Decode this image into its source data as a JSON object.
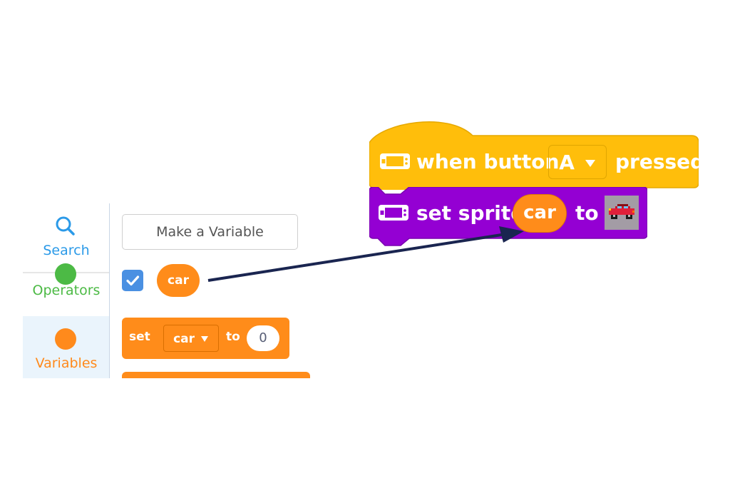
{
  "categories": [
    {
      "label": "Search",
      "icon": "search-icon",
      "color": "#2b9ae8"
    },
    {
      "label": "Operators",
      "icon": "operators-dot-icon",
      "color": "#4cba45"
    },
    {
      "label": "Variables",
      "icon": "variables-dot-icon",
      "color": "#ff8a1c"
    }
  ],
  "flyout": {
    "make_variable_label": "Make a Variable",
    "variable_name": "car",
    "variable_checked": true,
    "set_block": {
      "set_label": "set",
      "variable": "car",
      "to_label": "to",
      "value": "0"
    }
  },
  "script": {
    "hat_block": {
      "when_label": "when button",
      "button": "A",
      "pressed_label": "pressed",
      "color": "#ffbe0b"
    },
    "set_sprite_block": {
      "label": "set sprite",
      "variable": "car",
      "to_label": "to",
      "sprite": "car-sprite-icon",
      "color": "#9400d3"
    }
  },
  "colors": {
    "variables": "#ff8c1a",
    "events": "#ffbe0b",
    "sprites": "#9400d3",
    "checkbox": "#4a90e2",
    "arrow": "#1a2550"
  }
}
